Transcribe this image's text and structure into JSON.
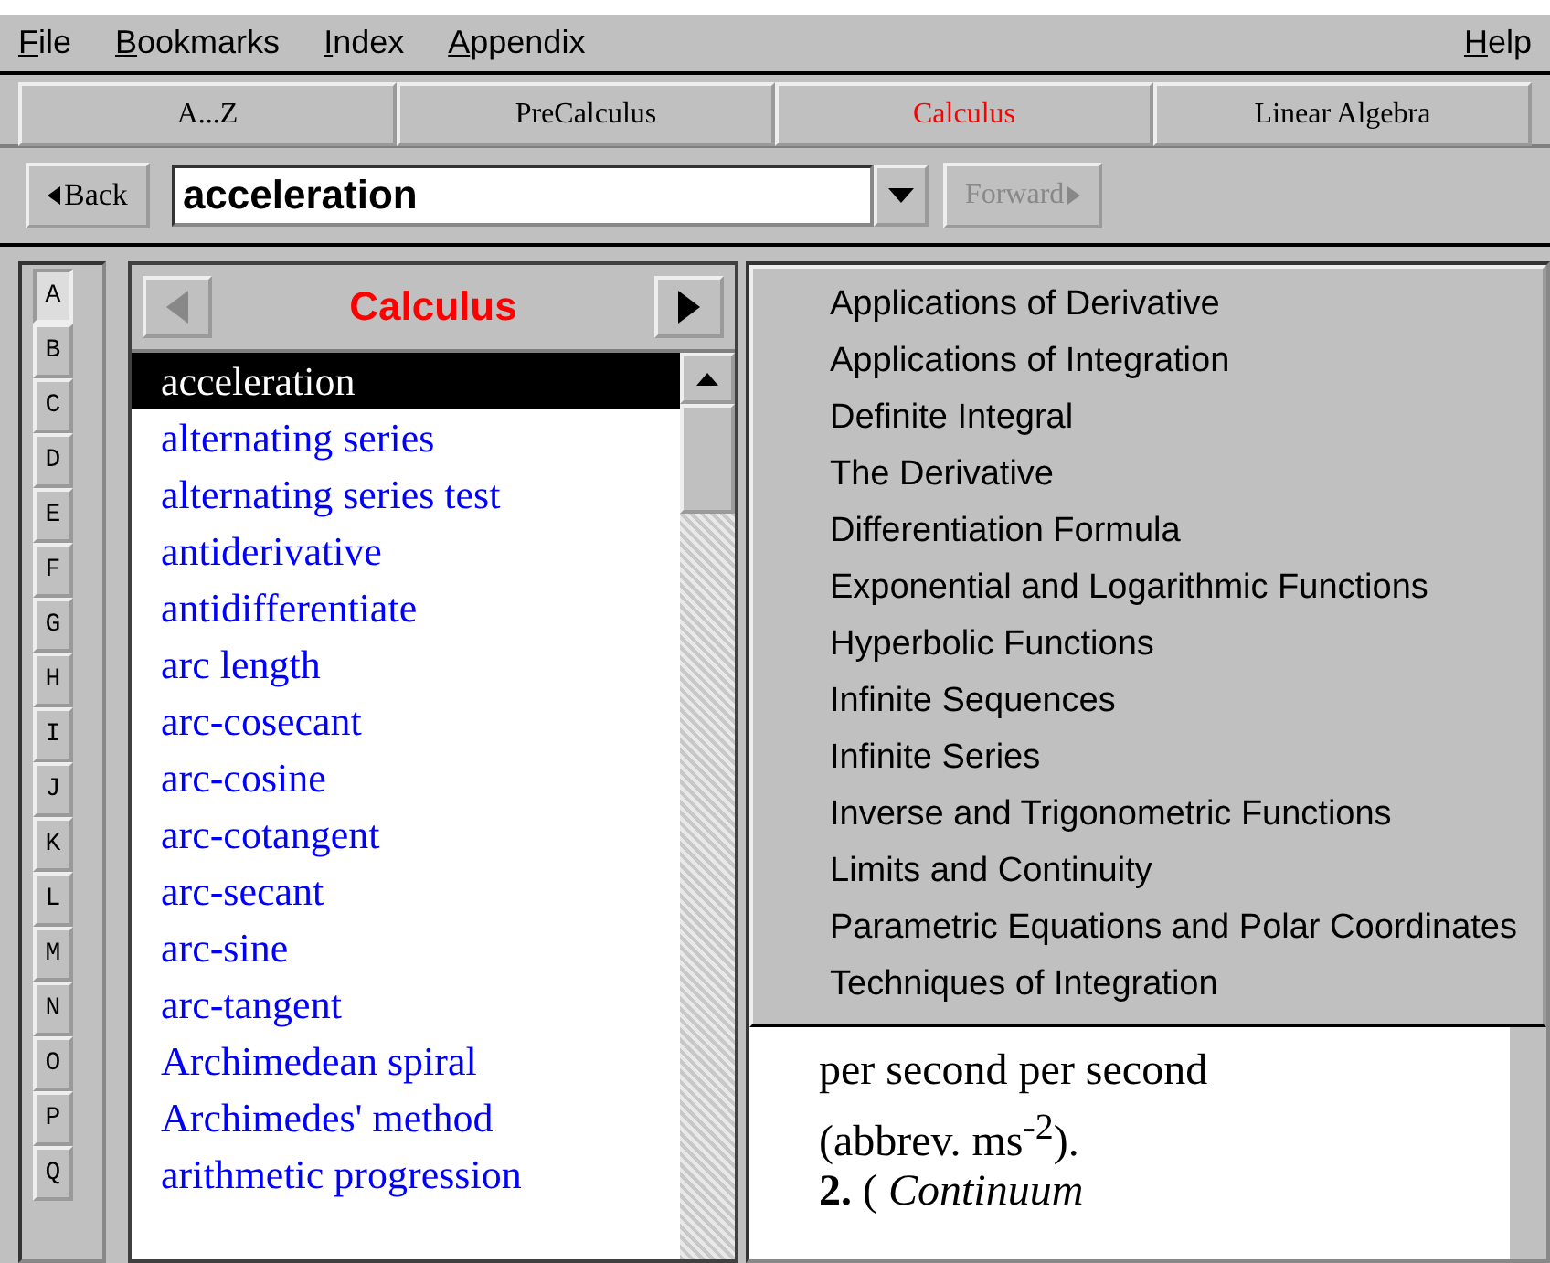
{
  "menu_bar": {
    "left": [
      {
        "accel": "F",
        "rest": "ile"
      },
      {
        "accel": "B",
        "rest": "ookmarks"
      },
      {
        "accel": "I",
        "rest": "ndex"
      },
      {
        "accel": "A",
        "rest": "ppendix"
      }
    ],
    "right": [
      {
        "accel": "H",
        "rest": "elp"
      }
    ]
  },
  "tabs": [
    {
      "label": "A...Z",
      "selected": false
    },
    {
      "label": "PreCalculus",
      "selected": false
    },
    {
      "label": "Calculus",
      "selected": true
    },
    {
      "label": "Linear Algebra",
      "selected": false
    }
  ],
  "toolbar": {
    "back": "Back",
    "search_value": "acceleration",
    "forward": "Forward",
    "forward_disabled": true
  },
  "letters": [
    {
      "label": "A",
      "selected": true
    },
    {
      "label": "B",
      "selected": false
    },
    {
      "label": "C",
      "selected": false
    },
    {
      "label": "D",
      "selected": false
    },
    {
      "label": "E",
      "selected": false
    },
    {
      "label": "F",
      "selected": false
    },
    {
      "label": "G",
      "selected": false
    },
    {
      "label": "H",
      "selected": false
    },
    {
      "label": "I",
      "selected": false
    },
    {
      "label": "J",
      "selected": false
    },
    {
      "label": "K",
      "selected": false
    },
    {
      "label": "L",
      "selected": false
    },
    {
      "label": "M",
      "selected": false
    },
    {
      "label": "N",
      "selected": false
    },
    {
      "label": "O",
      "selected": false
    },
    {
      "label": "P",
      "selected": false
    },
    {
      "label": "Q",
      "selected": false
    }
  ],
  "term_list": {
    "title": "Calculus",
    "prev_disabled": true,
    "items": [
      {
        "label": "acceleration",
        "selected": true
      },
      {
        "label": "alternating series",
        "selected": false
      },
      {
        "label": "alternating series test",
        "selected": false
      },
      {
        "label": "antiderivative",
        "selected": false
      },
      {
        "label": "antidifferentiate",
        "selected": false
      },
      {
        "label": "arc length",
        "selected": false
      },
      {
        "label": "arc-cosecant",
        "selected": false
      },
      {
        "label": "arc-cosine",
        "selected": false
      },
      {
        "label": "arc-cotangent",
        "selected": false
      },
      {
        "label": "arc-secant",
        "selected": false
      },
      {
        "label": "arc-sine",
        "selected": false
      },
      {
        "label": "arc-tangent",
        "selected": false
      },
      {
        "label": "Archimedean spiral",
        "selected": false
      },
      {
        "label": "Archimedes' method",
        "selected": false
      },
      {
        "label": "arithmetic progression",
        "selected": false
      }
    ]
  },
  "topic_menu": [
    "Applications of Derivative",
    "Applications of Integration",
    "Definite Integral",
    "The Derivative",
    "Differentiation Formula",
    "Exponential and Logarithmic Functions",
    "Hyperbolic Functions",
    "Infinite Sequences",
    "Infinite Series",
    "Inverse and Trigonometric Functions",
    "Limits and Continuity",
    "Parametric Equations and Polar Coordinates",
    "Techniques of Integration"
  ],
  "definition": [
    "per second per second",
    "(abbrev. ms$^{-2}$).",
    "**2.** ( *Continuum*"
  ]
}
